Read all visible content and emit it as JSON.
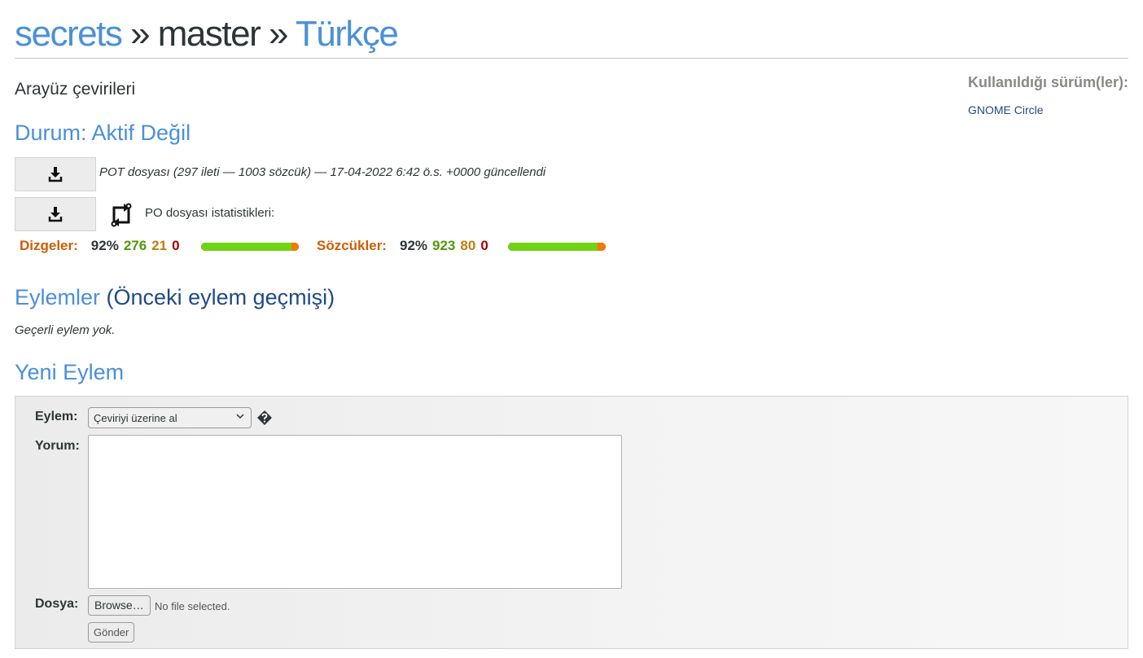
{
  "breadcrumb": {
    "module": "secrets",
    "sep1": "»",
    "branch": "master",
    "sep2": "»",
    "language": "Türkçe"
  },
  "domain_title": "Arayüz çevirileri",
  "status": "Durum: Aktif Değil",
  "sidebar": {
    "title": "Kullanıldığı sürüm(ler):",
    "release": "GNOME Circle"
  },
  "pot": {
    "info": "POT dosyası (297 ileti — 1003 sözcük) — 17-04-2022 6:42 ö.s. +0000 güncellendi"
  },
  "po": {
    "label": "PO dosyası istatistikleri:"
  },
  "stats": {
    "strings": {
      "label": "Dizgeler:",
      "percent": "92%",
      "translated": "276",
      "fuzzy": "21",
      "untranslated": "0",
      "translated_fraction": 0.929,
      "fuzzy_fraction": 0.071
    },
    "words": {
      "label": "Sözcükler:",
      "percent": "92%",
      "translated": "923",
      "fuzzy": "80",
      "untranslated": "0",
      "translated_fraction": 0.92,
      "fuzzy_fraction": 0.08
    }
  },
  "actions": {
    "title": "Eylemler",
    "history_link": "(Önceki eylem geçmişi)",
    "none": "Geçerli eylem yok."
  },
  "new_action": {
    "title": "Yeni Eylem",
    "action_label": "Eylem:",
    "action_value": "Çeviriyi üzerine al",
    "comment_label": "Yorum:",
    "file_label": "Dosya:",
    "browse_button": "Browse…",
    "no_file": "No file selected.",
    "submit_button": "Gönder"
  },
  "colors": {
    "link": "#4a90d9",
    "dark_link": "#204a87",
    "translated": "#73d216",
    "fuzzy": "#f57900",
    "untranslated": "#a40000",
    "label": "#ce5c00"
  },
  "icons": {
    "download": "download-icon",
    "sync": "sync-icon",
    "help": "help-icon",
    "chevron": "chevron-down-icon"
  }
}
